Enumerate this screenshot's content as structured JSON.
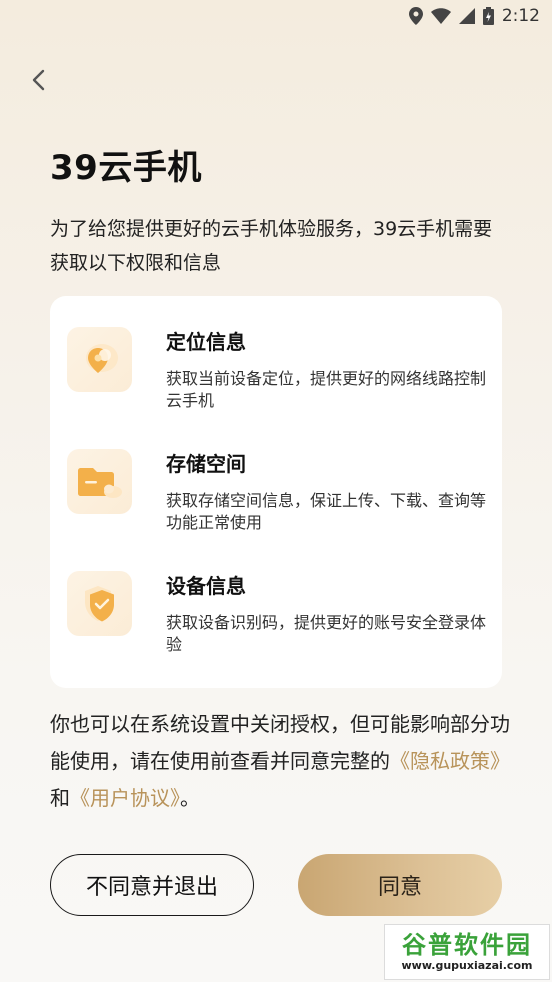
{
  "status_bar": {
    "time": "2:12"
  },
  "header": {
    "title": "39云手机"
  },
  "intro": "为了给您提供更好的云手机体验服务，39云手机需要获取以下权限和信息",
  "permissions": [
    {
      "title": "定位信息",
      "desc": "获取当前设备定位，提供更好的网络线路控制云手机",
      "icon": "location-icon"
    },
    {
      "title": "存储空间",
      "desc": "获取存储空间信息，保证上传、下载、查询等功能正常使用",
      "icon": "folder-icon"
    },
    {
      "title": "设备信息",
      "desc": "获取设备识别码，提供更好的账号安全登录体验",
      "icon": "shield-icon"
    }
  ],
  "notice": {
    "text_before": "你也可以在系统设置中关闭授权，但可能影响部分功能使用，请在使用前查看并同意完整的",
    "privacy_link": "《隐私政策》",
    "conjunction": "和",
    "agreement_link": "《用户协议》",
    "text_after": "。"
  },
  "buttons": {
    "disagree": "不同意并退出",
    "agree": "同意"
  },
  "watermark": {
    "main": "谷普软件园",
    "url": "www.gupuxiazai.com"
  },
  "colors": {
    "accent": "#b8935a",
    "icon_orange": "#f3b04a",
    "button_gold": "#d4b583"
  }
}
